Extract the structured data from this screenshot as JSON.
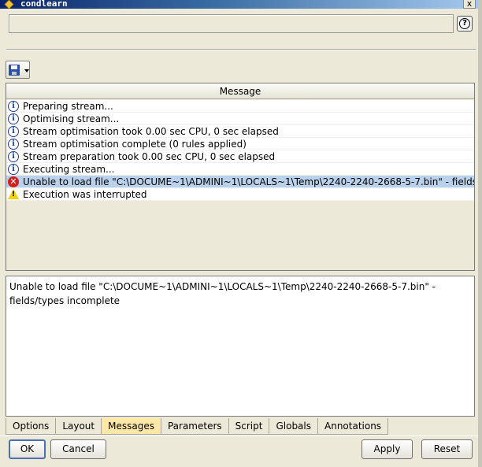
{
  "window": {
    "title": "condlearn",
    "close_glyph": "x"
  },
  "help_button": {
    "glyph": "?",
    "icon": "help-icon"
  },
  "toolbar": {
    "save_icon": "floppy-disk-icon",
    "dropdown_icon": "chevron-down-icon"
  },
  "messages": {
    "column_header": "Message",
    "rows": [
      {
        "type": "info",
        "icon_glyph": "i",
        "text": "Preparing stream..."
      },
      {
        "type": "info",
        "icon_glyph": "i",
        "text": "Optimising stream..."
      },
      {
        "type": "info",
        "icon_glyph": "i",
        "text": "Stream optimisation took 0.00 sec CPU, 0 sec elapsed"
      },
      {
        "type": "info",
        "icon_glyph": "i",
        "text": "Stream optimisation complete (0 rules applied)"
      },
      {
        "type": "info",
        "icon_glyph": "i",
        "text": "Stream preparation took 0.00 sec CPU, 0 sec elapsed"
      },
      {
        "type": "info",
        "icon_glyph": "i",
        "text": "Executing stream..."
      },
      {
        "type": "error",
        "icon_glyph": "✕",
        "text": "Unable to load file \"C:\\DOCUME~1\\ADMINI~1\\LOCALS~1\\Temp\\2240-2240-2668-5-7.bin\" - fields/types ...",
        "selected": true
      },
      {
        "type": "warning",
        "icon_glyph": "!",
        "text": "Execution was interrupted"
      }
    ]
  },
  "detail": {
    "text": "Unable to load file \"C:\\DOCUME~1\\ADMINI~1\\LOCALS~1\\Temp\\2240-2240-2668-5-7.bin\" - fields/types incomplete"
  },
  "tabs": [
    {
      "label": "Options",
      "active": false
    },
    {
      "label": "Layout",
      "active": false
    },
    {
      "label": "Messages",
      "active": true
    },
    {
      "label": "Parameters",
      "active": false
    },
    {
      "label": "Script",
      "active": false
    },
    {
      "label": "Globals",
      "active": false
    },
    {
      "label": "Annotations",
      "active": false
    }
  ],
  "buttons": {
    "ok": "OK",
    "cancel": "Cancel",
    "apply": "Apply",
    "reset": "Reset"
  },
  "colors": {
    "selected_row": "#b9d1ea",
    "active_tab": "#ffe8a6",
    "dialog_bg": "#ece9d8"
  }
}
